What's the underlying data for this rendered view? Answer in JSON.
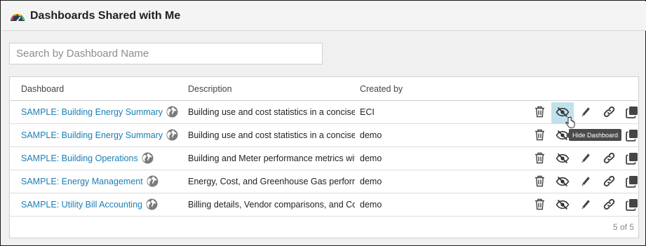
{
  "header": {
    "title": "Dashboards Shared with Me",
    "icon": "speedometer-icon"
  },
  "search": {
    "placeholder": "Search by Dashboard Name",
    "value": ""
  },
  "table": {
    "columns": [
      "Dashboard",
      "Description",
      "Created by"
    ],
    "rows": [
      {
        "dashboard": "SAMPLE: Building Energy Summary",
        "description": "Building use and cost statistics in a concise",
        "created_by": "ECI"
      },
      {
        "dashboard": "SAMPLE: Building Energy Summary",
        "description": "Building use and cost statistics in a concise",
        "created_by": "demo"
      },
      {
        "dashboard": "SAMPLE: Building Operations",
        "description": "Building and Meter performance metrics with",
        "created_by": "demo"
      },
      {
        "dashboard": "SAMPLE: Energy Management",
        "description": "Energy, Cost, and Greenhouse Gas performan",
        "created_by": "demo"
      },
      {
        "dashboard": "SAMPLE: Utility Bill Accounting",
        "description": "Billing details, Vendor comparisons, and Cos",
        "created_by": "demo"
      }
    ],
    "row_actions": [
      "trash-icon",
      "hide-icon",
      "pencil-icon",
      "link-icon",
      "copy-icon"
    ],
    "count_text": "5 of 5"
  },
  "tooltip": {
    "text": "Hide Dashboard"
  },
  "colors": {
    "link": "#1a7fb5",
    "highlight": "#bfe2ec",
    "icon": "#444444"
  }
}
